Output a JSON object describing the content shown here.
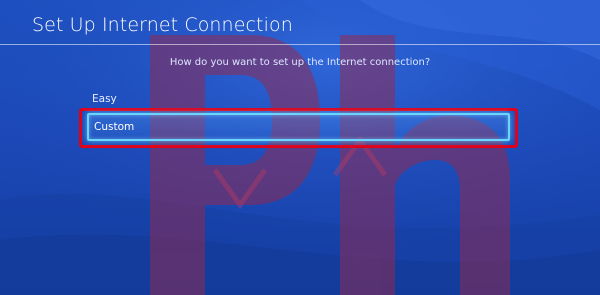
{
  "screen": {
    "title": "Set Up Internet Connection",
    "question": "How do you want to set up the Internet connection?"
  },
  "options": {
    "easy_label": "Easy",
    "custom_label": "Custom"
  },
  "colors": {
    "background": "#1b48b6",
    "selection_border": "#6ad6ff",
    "annotation_border": "#e0001a",
    "watermark": "#8a2a4a"
  }
}
